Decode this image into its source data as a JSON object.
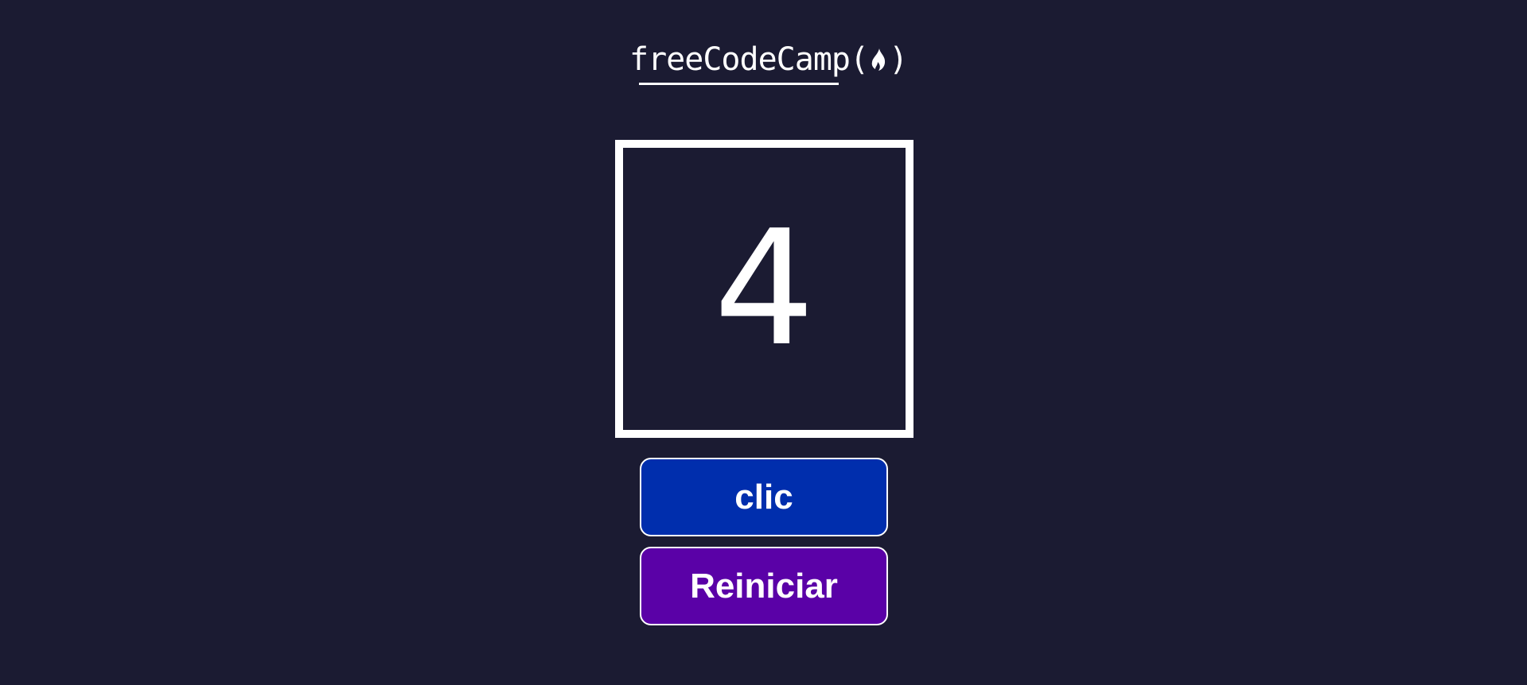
{
  "header": {
    "logo_text": "freeCodeCamp",
    "logo_open_paren": "(",
    "logo_close_paren": ")",
    "logo_icon": "flame-icon"
  },
  "counter": {
    "value": "4"
  },
  "buttons": {
    "click_label": "clic",
    "reset_label": "Reiniciar"
  },
  "colors": {
    "background": "#1b1b32",
    "click_button": "#002ead",
    "reset_button": "#5a01a7",
    "foreground": "#ffffff"
  }
}
